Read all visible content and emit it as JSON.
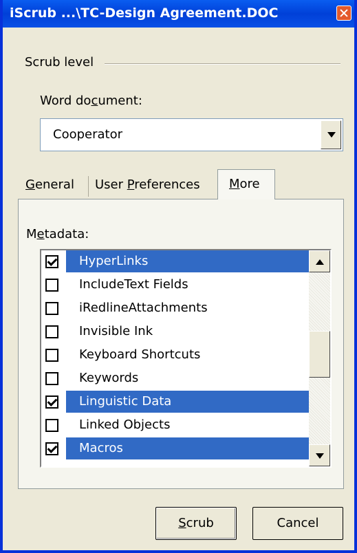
{
  "window": {
    "title": "iScrub ...\\TC-Design Agreement.DOC"
  },
  "scrub_level": {
    "label": "Scrub level"
  },
  "word_document": {
    "label_before": "Word do",
    "label_ul": "c",
    "label_after": "ument:",
    "selected_value": "Cooperator"
  },
  "tabs": [
    {
      "ul": "G",
      "rest": "eneral"
    },
    {
      "before": "User ",
      "ul": "P",
      "rest": "references"
    },
    {
      "ul": "M",
      "rest": "ore"
    }
  ],
  "metadata": {
    "label_before": "M",
    "label_ul": "e",
    "label_after": "tadata:",
    "items": [
      {
        "label": "HyperLinks",
        "checked": true,
        "selected": true
      },
      {
        "label": "IncludeText Fields",
        "checked": false,
        "selected": false
      },
      {
        "label": "iRedlineAttachments",
        "checked": false,
        "selected": false
      },
      {
        "label": "Invisible Ink",
        "checked": false,
        "selected": false
      },
      {
        "label": "Keyboard Shortcuts",
        "checked": false,
        "selected": false
      },
      {
        "label": "Keywords",
        "checked": false,
        "selected": false
      },
      {
        "label": "Linguistic Data",
        "checked": true,
        "selected": true
      },
      {
        "label": "Linked Objects",
        "checked": false,
        "selected": false
      },
      {
        "label": "Macros",
        "checked": true,
        "selected": true
      }
    ]
  },
  "buttons": {
    "scrub": {
      "ul": "S",
      "rest": "crub"
    },
    "cancel": "Cancel"
  }
}
